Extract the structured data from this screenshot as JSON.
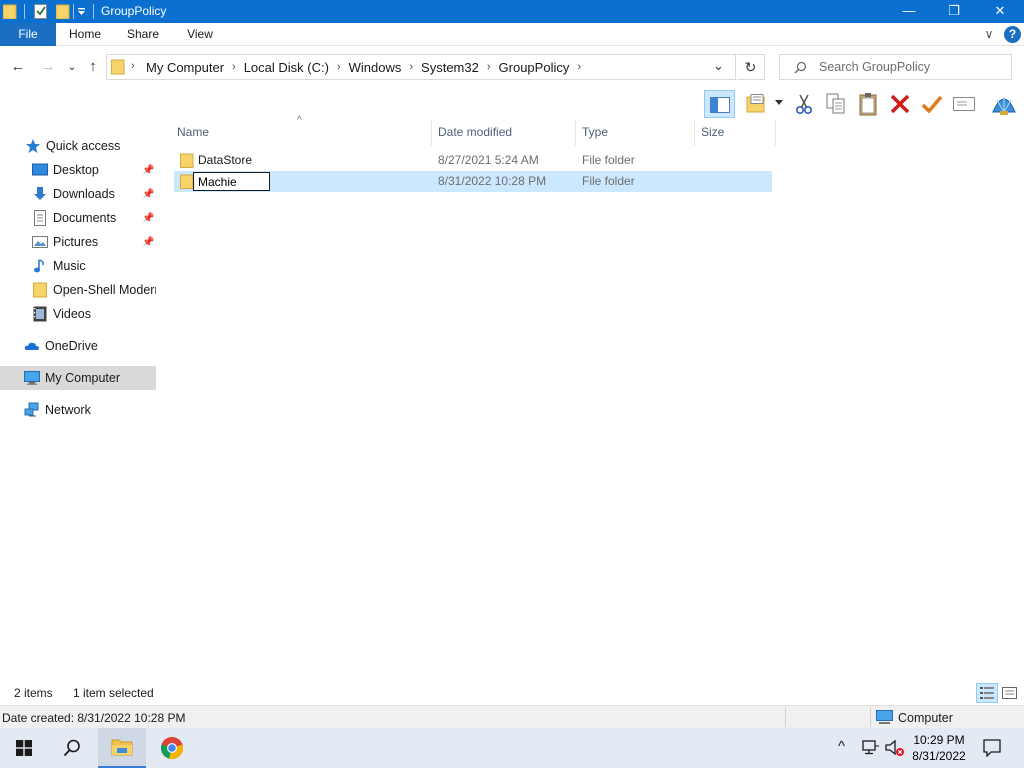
{
  "window": {
    "title": "GroupPolicy",
    "controls": {
      "minimize": "—",
      "maximize": "❐",
      "close": "✕"
    }
  },
  "ribbon": {
    "tabs": [
      "File",
      "Home",
      "Share",
      "View"
    ],
    "expand": "∨",
    "help": "?"
  },
  "nav": {
    "back": "←",
    "forward": "→",
    "recent": "⌄",
    "up": "↑",
    "refresh": "↻",
    "dropdown": "⌄"
  },
  "address": {
    "crumbs": [
      "My Computer",
      "Local Disk (C:)",
      "Windows",
      "System32",
      "GroupPolicy"
    ]
  },
  "search": {
    "placeholder": "Search GroupPolicy"
  },
  "sidebar": {
    "items": [
      {
        "label": "Quick access",
        "icon": "star-icon"
      },
      {
        "label": "Desktop",
        "icon": "desktop-icon",
        "pinned": true
      },
      {
        "label": "Downloads",
        "icon": "download-icon",
        "pinned": true
      },
      {
        "label": "Documents",
        "icon": "document-icon",
        "pinned": true
      },
      {
        "label": "Pictures",
        "icon": "pictures-icon",
        "pinned": true
      },
      {
        "label": "Music",
        "icon": "music-icon"
      },
      {
        "label": "Open-Shell Modern",
        "icon": "folder-icon"
      },
      {
        "label": "Videos",
        "icon": "video-icon"
      },
      {
        "label": "OneDrive",
        "icon": "cloud-icon"
      },
      {
        "label": "My Computer",
        "icon": "computer-icon",
        "selected": true
      },
      {
        "label": "Network",
        "icon": "network-icon"
      }
    ]
  },
  "columns": {
    "name": "Name",
    "date": "Date modified",
    "type": "Type",
    "size": "Size"
  },
  "files": [
    {
      "name": "DataStore",
      "date": "8/27/2021 5:24 AM",
      "type": "File folder",
      "size": ""
    },
    {
      "name": "Machie",
      "date": "8/31/2022 10:28 PM",
      "type": "File folder",
      "size": "",
      "selected": true,
      "renaming": true
    }
  ],
  "status": {
    "count": "2 items",
    "selection": "1 item selected"
  },
  "details": {
    "created": "Date created: 8/31/2022 10:28 PM",
    "location": "Computer"
  },
  "taskbar": {
    "time": "10:29 PM",
    "date": "8/31/2022",
    "tray_chevron": "^"
  },
  "colors": {
    "titlebar": "#0b6fd0",
    "selection": "#cce8ff",
    "accent": "#1a6fc2"
  }
}
